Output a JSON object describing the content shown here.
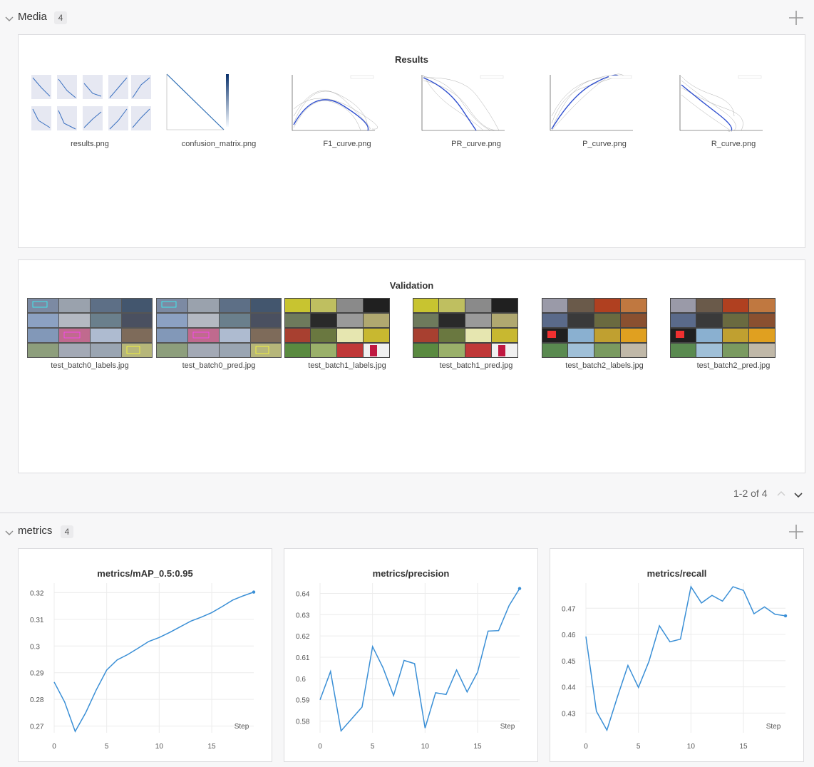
{
  "media": {
    "title": "Media",
    "count": "4",
    "results": {
      "title": "Results",
      "items": [
        "results.png",
        "confusion_matrix.png",
        "F1_curve.png",
        "PR_curve.png",
        "P_curve.png",
        "R_curve.png"
      ]
    },
    "validation": {
      "title": "Validation",
      "items": [
        "test_batch0_labels.jpg",
        "test_batch0_pred.jpg",
        "test_batch1_labels.jpg",
        "test_batch1_pred.jpg",
        "test_batch2_labels.jpg",
        "test_batch2_pred.jpg"
      ]
    },
    "pager": "1-2 of 4"
  },
  "metrics": {
    "title": "metrics",
    "count": "4"
  },
  "colors": {
    "accent": "#3a8fd6",
    "grid": "#ececec"
  },
  "chart_data": [
    {
      "type": "line",
      "title": "metrics/mAP_0.5:0.95",
      "xlabel": "Step",
      "x": [
        0,
        1,
        2,
        3,
        4,
        5,
        6,
        7,
        8,
        9,
        10,
        11,
        12,
        13,
        14,
        15,
        16,
        17,
        18,
        19
      ],
      "values": [
        0.2865,
        0.279,
        0.268,
        0.275,
        0.2835,
        0.291,
        0.2948,
        0.2968,
        0.2992,
        0.3017,
        0.3032,
        0.3051,
        0.3072,
        0.3093,
        0.3108,
        0.3125,
        0.3148,
        0.3172,
        0.3188,
        0.3202
      ],
      "xticks": [
        0,
        5,
        10,
        15
      ],
      "yticks": [
        "0.27",
        "0.28",
        "0.29",
        "0.3",
        "0.31",
        "0.32"
      ],
      "ytickvals": [
        0.27,
        0.28,
        0.29,
        0.3,
        0.31,
        0.32
      ],
      "ylim": [
        0.2675,
        0.3225
      ],
      "xlim": [
        0,
        19
      ]
    },
    {
      "type": "line",
      "title": "metrics/precision",
      "xlabel": "Step",
      "x": [
        0,
        1,
        2,
        3,
        4,
        5,
        6,
        7,
        8,
        9,
        10,
        11,
        12,
        13,
        14,
        15,
        16,
        17,
        18,
        19
      ],
      "values": [
        0.59,
        0.6033,
        0.5754,
        0.581,
        0.5866,
        0.615,
        0.605,
        0.592,
        0.6085,
        0.607,
        0.5767,
        0.5933,
        0.5925,
        0.604,
        0.5937,
        0.603,
        0.6223,
        0.6225,
        0.6343,
        0.6423
      ],
      "xticks": [
        0,
        5,
        10,
        15
      ],
      "yticks": [
        "0.58",
        "0.59",
        "0.6",
        "0.61",
        "0.62",
        "0.63",
        "0.64"
      ],
      "ytickvals": [
        0.58,
        0.59,
        0.6,
        0.61,
        0.62,
        0.63,
        0.64
      ],
      "ylim": [
        0.5745,
        0.6435
      ],
      "xlim": [
        0,
        19
      ]
    },
    {
      "type": "line",
      "title": "metrics/recall",
      "xlabel": "Step",
      "x": [
        0,
        1,
        2,
        3,
        4,
        5,
        6,
        7,
        8,
        9,
        10,
        11,
        12,
        13,
        14,
        15,
        16,
        17,
        18,
        19
      ],
      "values": [
        0.4592,
        0.4307,
        0.4235,
        0.4362,
        0.4482,
        0.4398,
        0.4497,
        0.4633,
        0.4572,
        0.4582,
        0.4782,
        0.472,
        0.4749,
        0.4727,
        0.4782,
        0.4768,
        0.4679,
        0.4705,
        0.4677,
        0.4671
      ],
      "xticks": [
        0,
        5,
        10,
        15
      ],
      "yticks": [
        "0.43",
        "0.44",
        "0.45",
        "0.46",
        "0.47"
      ],
      "ytickvals": [
        0.43,
        0.44,
        0.45,
        0.46,
        0.47
      ],
      "ylim": [
        0.4225,
        0.4785
      ],
      "xlim": [
        0,
        19
      ]
    }
  ]
}
